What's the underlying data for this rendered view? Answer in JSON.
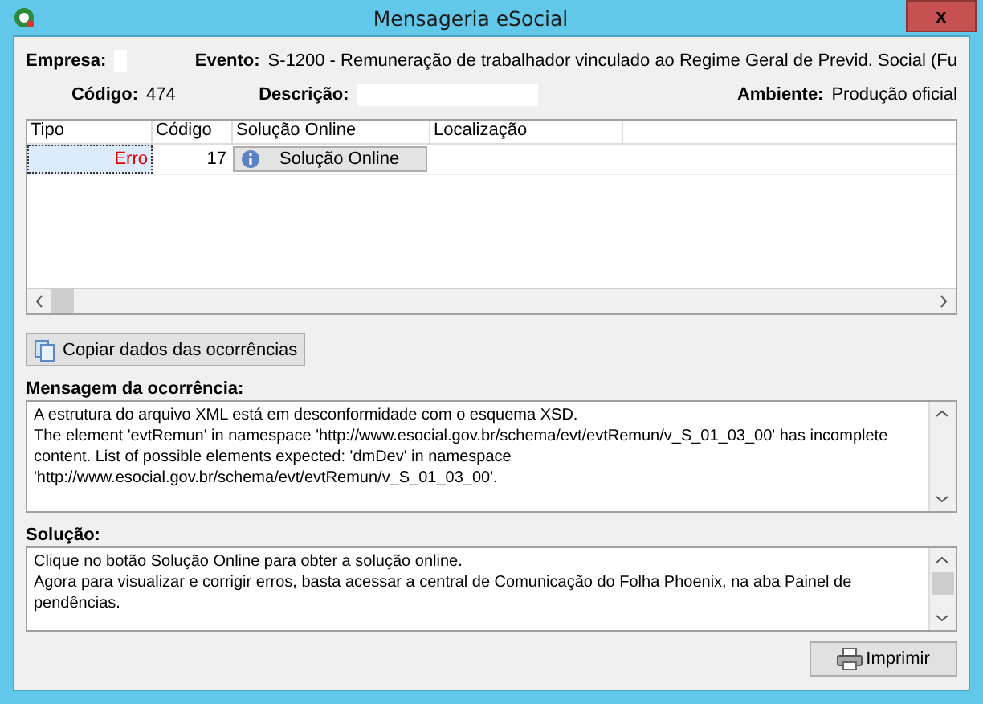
{
  "window": {
    "title": "Mensageria eSocial",
    "close": "x"
  },
  "header": {
    "empresa": {
      "label": "Empresa:"
    },
    "evento": {
      "label": "Evento:",
      "value": "S-1200 - Remuneração de trabalhador vinculado ao Regime Geral de Previd. Social (Fu"
    },
    "codigo": {
      "label": "Código:",
      "value": "474"
    },
    "descricao": {
      "label": "Descrição:"
    },
    "ambiente": {
      "label": "Ambiente:",
      "value": "Produção oficial"
    }
  },
  "table": {
    "columns": [
      "Tipo",
      "Código",
      "Solução Online",
      "Localização"
    ],
    "rows": [
      {
        "tipo": "Erro",
        "codigo": "17",
        "solucao": "Solução Online",
        "selected": true
      }
    ]
  },
  "copy_button": "Copiar dados das ocorrências",
  "mensagem": {
    "label": "Mensagem da ocorrência:",
    "lines": [
      "A estrutura do arquivo XML está em desconformidade com o esquema XSD.",
      "The element 'evtRemun' in namespace 'http://www.esocial.gov.br/schema/evt/evtRemun/v_S_01_03_00' has incomplete content. List of possible elements expected: 'dmDev' in namespace 'http://www.esocial.gov.br/schema/evt/evtRemun/v_S_01_03_00'."
    ]
  },
  "solucao": {
    "label": "Solução:",
    "lines": [
      "Clique no botão Solução Online para obter a solução online.",
      "Agora para visualizar e corrigir erros, basta acessar a central de Comunicação do Folha Phoenix, na aba Painel de pendências."
    ]
  },
  "print_button": "Imprimir"
}
